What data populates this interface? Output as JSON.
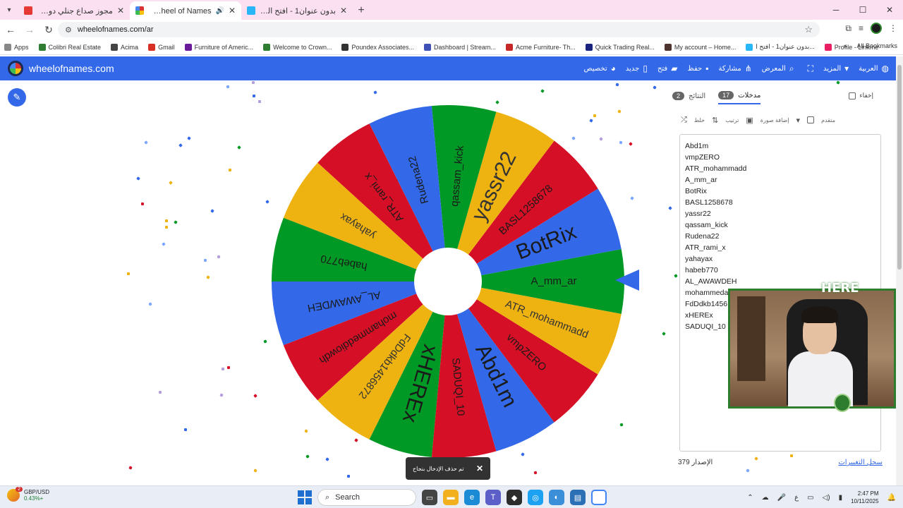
{
  "browser": {
    "tabs": [
      {
        "label": "مجوز صداع جنلي دوحه - رماني ر",
        "favicon_color": "#e53935",
        "active": false
      },
      {
        "label": "Wheel of Names | العشوائي",
        "favicon_color": "#3369e8",
        "active": true
      },
      {
        "label": "بدون عنوان1 - افتح الصندوق",
        "favicon_color": "#ffffff",
        "active": false
      },
      {
        "label": "",
        "favicon_color": "#29b6f6",
        "active": false
      }
    ],
    "url": "wheelofnames.com/ar",
    "bookmarks": [
      {
        "label": "Apps",
        "color": "#888888"
      },
      {
        "label": "Colibri Real Estate",
        "color": "#2e7d32"
      },
      {
        "label": "Acima",
        "color": "#444444"
      },
      {
        "label": "Gmail",
        "color": "#d93025"
      },
      {
        "label": "Furniture of Americ...",
        "color": "#6a1b9a"
      },
      {
        "label": "Welcome to Crown...",
        "color": "#2e7d32"
      },
      {
        "label": "Poundex Associates...",
        "color": "#333333"
      },
      {
        "label": "Dashboard | Stream...",
        "color": "#3f51b5"
      },
      {
        "label": "Acme Furniture- Th...",
        "color": "#c62828"
      },
      {
        "label": "Quick Trading Real...",
        "color": "#1a237e"
      },
      {
        "label": "My account – Home...",
        "color": "#4e342e"
      },
      {
        "label": "بدون عنوان1 - افتح ا...",
        "color": "#29b6f6"
      },
      {
        "label": "Profile - Linkme",
        "color": "#e91e63"
      }
    ],
    "all_bookmarks": "All Bookmarks"
  },
  "site": {
    "brand": "wheelofnames.com",
    "menu": [
      {
        "label": "العربية",
        "icon": "globe-icon"
      },
      {
        "label": "المزيد",
        "icon": "chevron-down-icon"
      },
      {
        "label": "",
        "icon": "fullscreen-icon"
      },
      {
        "label": "المعرض",
        "icon": "search-icon"
      },
      {
        "label": "مشاركة",
        "icon": "share-icon"
      },
      {
        "label": "حفظ",
        "icon": "save-icon"
      },
      {
        "label": "فتح",
        "icon": "folder-icon"
      },
      {
        "label": "جديد",
        "icon": "file-icon"
      },
      {
        "label": "تخصيص",
        "icon": "palette-icon"
      }
    ]
  },
  "wheel": {
    "colors": [
      "#3369e8",
      "#009925",
      "#eeb211",
      "#d50f25"
    ],
    "segments": [
      "BotRix",
      "BASL1258678",
      "yassr22",
      "qassam_kick",
      "Rudena22",
      "ATR_rami_x",
      "yahayax",
      "habeb770",
      "AL_AWAWDEH",
      "mohammeddiowdh",
      "FdDdkb1456872",
      "xHEREx",
      "SADUQI_10",
      "Abd1m",
      "vmpZERO",
      "ATR_mohammadd",
      "A_mm_ar"
    ]
  },
  "panel": {
    "tab_entries": "مدخلات",
    "entries_count": "17",
    "tab_results": "النتائج",
    "results_count": "2",
    "hide_label": "إخفاء",
    "tools": {
      "shuffle": "خلط",
      "sort": "ترتيب",
      "add_image": "إضافة صورة",
      "advanced": "متقدم"
    },
    "entries": [
      "Abd1m",
      "vmpZERO",
      "ATR_mohammadd",
      "A_mm_ar",
      "BotRix",
      "BASL1258678",
      "yassr22",
      "qassam_kick",
      "Rudena22",
      "ATR_rami_x",
      "yahayax",
      "habeb770",
      "AL_AWAWDEH",
      "mohammeda",
      "FdDdkb1456",
      "xHEREx",
      "SADUQI_10"
    ],
    "version_label": "الإصدار 379",
    "changelog_link": "سجل التغييرات"
  },
  "toast": {
    "message": "تم حذف الإدخال بنجاح"
  },
  "webcam": {
    "label": "HERE"
  },
  "taskbar": {
    "ticker_pair": "GBP/USD",
    "ticker_change": "0.43%+",
    "ticker_badge": "2",
    "search_placeholder": "Search",
    "time": "2:47 PM",
    "date": "10/11/2025",
    "lang": "ع"
  }
}
